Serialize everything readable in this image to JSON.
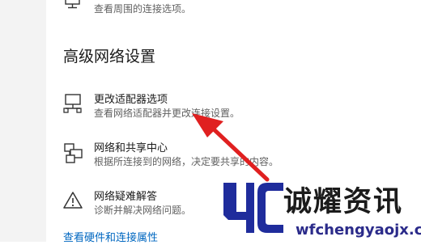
{
  "top_item": {
    "icon": "desktop-icon",
    "description": "查看周围的连接选项。"
  },
  "section": {
    "heading": "高级网络设置"
  },
  "items": [
    {
      "icon": "network-adapter-icon",
      "title": "更改适配器选项",
      "description": "查看网络适配器并更改连接设置。"
    },
    {
      "icon": "network-sharing-icon",
      "title": "网络和共享中心",
      "description": "根据所连接到的网络，决定要共享的内容。"
    },
    {
      "icon": "warning-icon",
      "title": "网络疑难解答",
      "description": "诊断并解决网络问题。"
    }
  ],
  "bottom_link": "查看硬件和连接属性",
  "annotation": {
    "arrow_color": "#e02020"
  },
  "watermark": {
    "name": "诚耀资讯",
    "url": "wfchengyaojx.cn",
    "logo_color": "#1f2c9c"
  }
}
